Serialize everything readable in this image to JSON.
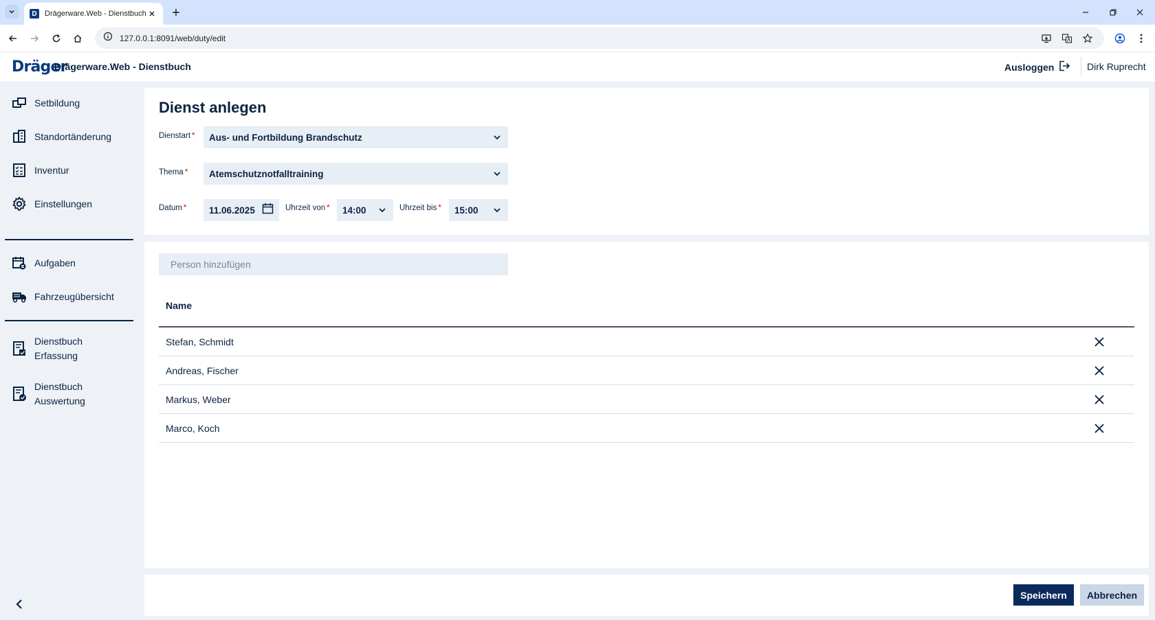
{
  "browser": {
    "tab_title": "Drägerware.Web - Dienstbuch",
    "favicon_letter": "D",
    "url": "127.0.0.1:8091/web/duty/edit"
  },
  "header": {
    "logo": "Dräger",
    "app_title": "Drägerware.Web - Dienstbuch",
    "logout_label": "Ausloggen",
    "user_name": "Dirk Ruprecht"
  },
  "sidebar": {
    "items": [
      {
        "label": "Setbildung",
        "icon": "set-icon"
      },
      {
        "label": "Standortänderung",
        "icon": "building-icon"
      },
      {
        "label": "Inventur",
        "icon": "checklist-icon"
      },
      {
        "label": "Einstellungen",
        "icon": "gear-icon"
      },
      {
        "label": "Aufgaben",
        "icon": "calendar-task-icon"
      },
      {
        "label": "Fahrzeugübersicht",
        "icon": "truck-icon"
      },
      {
        "label_line1": "Dienstbuch",
        "label_line2": "Erfassung",
        "icon": "book-edit-icon"
      },
      {
        "label_line1": "Dienstbuch",
        "label_line2": "Auswertung",
        "icon": "book-check-icon"
      }
    ]
  },
  "form": {
    "title": "Dienst anlegen",
    "dienstart_label": "Dienstart",
    "dienstart_value": "Aus- und Fortbildung Brandschutz",
    "thema_label": "Thema",
    "thema_value": "Atemschutznotfalltraining",
    "datum_label": "Datum",
    "datum_value": "11.06.2025",
    "von_label": "Uhrzeit von",
    "von_value": "14:00",
    "bis_label": "Uhrzeit bis",
    "bis_value": "15:00",
    "required_mark": "*"
  },
  "persons": {
    "placeholder": "Person hinzufügen",
    "column_name": "Name",
    "rows": [
      {
        "name": "Stefan, Schmidt"
      },
      {
        "name": "Andreas, Fischer"
      },
      {
        "name": "Markus, Weber"
      },
      {
        "name": "Marco, Koch"
      }
    ]
  },
  "actions": {
    "save_label": "Speichern",
    "cancel_label": "Abbrechen"
  },
  "colors": {
    "primary": "#0b2a5c",
    "text": "#0b2341",
    "required": "#d0021b",
    "field_bg": "#e8eef5"
  }
}
